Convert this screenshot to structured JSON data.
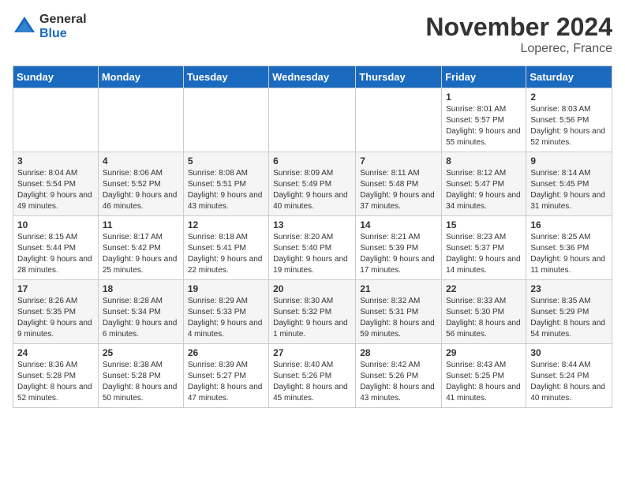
{
  "logo": {
    "general": "General",
    "blue": "Blue"
  },
  "title": "November 2024",
  "location": "Loperec, France",
  "days_header": [
    "Sunday",
    "Monday",
    "Tuesday",
    "Wednesday",
    "Thursday",
    "Friday",
    "Saturday"
  ],
  "weeks": [
    [
      {
        "day": "",
        "info": ""
      },
      {
        "day": "",
        "info": ""
      },
      {
        "day": "",
        "info": ""
      },
      {
        "day": "",
        "info": ""
      },
      {
        "day": "",
        "info": ""
      },
      {
        "day": "1",
        "info": "Sunrise: 8:01 AM\nSunset: 5:57 PM\nDaylight: 9 hours and 55 minutes."
      },
      {
        "day": "2",
        "info": "Sunrise: 8:03 AM\nSunset: 5:56 PM\nDaylight: 9 hours and 52 minutes."
      }
    ],
    [
      {
        "day": "3",
        "info": "Sunrise: 8:04 AM\nSunset: 5:54 PM\nDaylight: 9 hours and 49 minutes."
      },
      {
        "day": "4",
        "info": "Sunrise: 8:06 AM\nSunset: 5:52 PM\nDaylight: 9 hours and 46 minutes."
      },
      {
        "day": "5",
        "info": "Sunrise: 8:08 AM\nSunset: 5:51 PM\nDaylight: 9 hours and 43 minutes."
      },
      {
        "day": "6",
        "info": "Sunrise: 8:09 AM\nSunset: 5:49 PM\nDaylight: 9 hours and 40 minutes."
      },
      {
        "day": "7",
        "info": "Sunrise: 8:11 AM\nSunset: 5:48 PM\nDaylight: 9 hours and 37 minutes."
      },
      {
        "day": "8",
        "info": "Sunrise: 8:12 AM\nSunset: 5:47 PM\nDaylight: 9 hours and 34 minutes."
      },
      {
        "day": "9",
        "info": "Sunrise: 8:14 AM\nSunset: 5:45 PM\nDaylight: 9 hours and 31 minutes."
      }
    ],
    [
      {
        "day": "10",
        "info": "Sunrise: 8:15 AM\nSunset: 5:44 PM\nDaylight: 9 hours and 28 minutes."
      },
      {
        "day": "11",
        "info": "Sunrise: 8:17 AM\nSunset: 5:42 PM\nDaylight: 9 hours and 25 minutes."
      },
      {
        "day": "12",
        "info": "Sunrise: 8:18 AM\nSunset: 5:41 PM\nDaylight: 9 hours and 22 minutes."
      },
      {
        "day": "13",
        "info": "Sunrise: 8:20 AM\nSunset: 5:40 PM\nDaylight: 9 hours and 19 minutes."
      },
      {
        "day": "14",
        "info": "Sunrise: 8:21 AM\nSunset: 5:39 PM\nDaylight: 9 hours and 17 minutes."
      },
      {
        "day": "15",
        "info": "Sunrise: 8:23 AM\nSunset: 5:37 PM\nDaylight: 9 hours and 14 minutes."
      },
      {
        "day": "16",
        "info": "Sunrise: 8:25 AM\nSunset: 5:36 PM\nDaylight: 9 hours and 11 minutes."
      }
    ],
    [
      {
        "day": "17",
        "info": "Sunrise: 8:26 AM\nSunset: 5:35 PM\nDaylight: 9 hours and 9 minutes."
      },
      {
        "day": "18",
        "info": "Sunrise: 8:28 AM\nSunset: 5:34 PM\nDaylight: 9 hours and 6 minutes."
      },
      {
        "day": "19",
        "info": "Sunrise: 8:29 AM\nSunset: 5:33 PM\nDaylight: 9 hours and 4 minutes."
      },
      {
        "day": "20",
        "info": "Sunrise: 8:30 AM\nSunset: 5:32 PM\nDaylight: 9 hours and 1 minute."
      },
      {
        "day": "21",
        "info": "Sunrise: 8:32 AM\nSunset: 5:31 PM\nDaylight: 8 hours and 59 minutes."
      },
      {
        "day": "22",
        "info": "Sunrise: 8:33 AM\nSunset: 5:30 PM\nDaylight: 8 hours and 56 minutes."
      },
      {
        "day": "23",
        "info": "Sunrise: 8:35 AM\nSunset: 5:29 PM\nDaylight: 8 hours and 54 minutes."
      }
    ],
    [
      {
        "day": "24",
        "info": "Sunrise: 8:36 AM\nSunset: 5:28 PM\nDaylight: 8 hours and 52 minutes."
      },
      {
        "day": "25",
        "info": "Sunrise: 8:38 AM\nSunset: 5:28 PM\nDaylight: 8 hours and 50 minutes."
      },
      {
        "day": "26",
        "info": "Sunrise: 8:39 AM\nSunset: 5:27 PM\nDaylight: 8 hours and 47 minutes."
      },
      {
        "day": "27",
        "info": "Sunrise: 8:40 AM\nSunset: 5:26 PM\nDaylight: 8 hours and 45 minutes."
      },
      {
        "day": "28",
        "info": "Sunrise: 8:42 AM\nSunset: 5:26 PM\nDaylight: 8 hours and 43 minutes."
      },
      {
        "day": "29",
        "info": "Sunrise: 8:43 AM\nSunset: 5:25 PM\nDaylight: 8 hours and 41 minutes."
      },
      {
        "day": "30",
        "info": "Sunrise: 8:44 AM\nSunset: 5:24 PM\nDaylight: 8 hours and 40 minutes."
      }
    ]
  ]
}
